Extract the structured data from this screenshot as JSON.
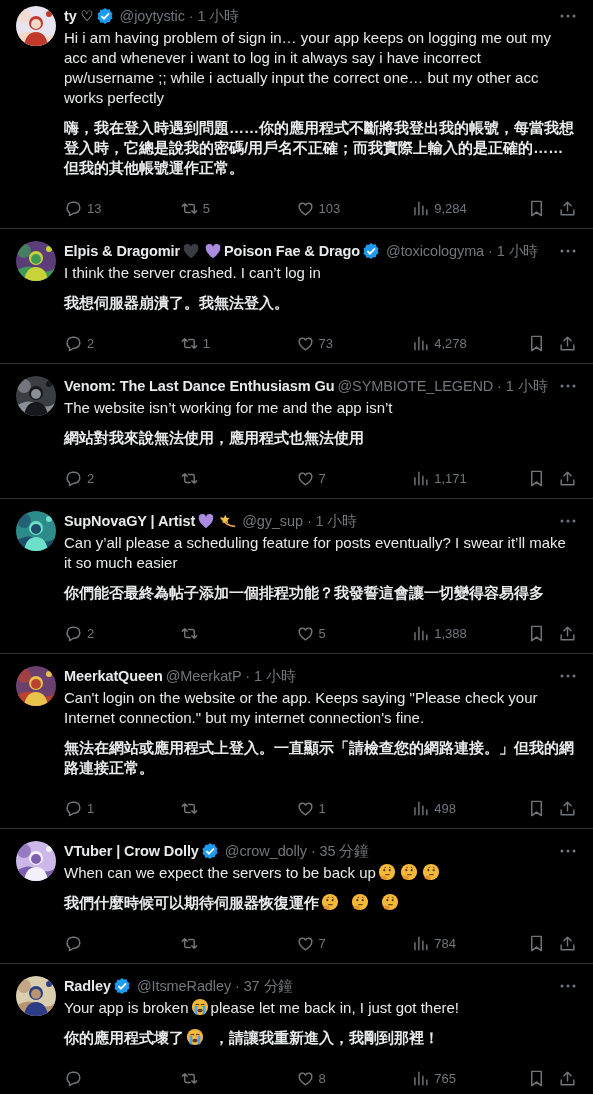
{
  "replies": [
    {
      "name": [
        {
          "kind": "text",
          "text": "ty ♡"
        }
      ],
      "verified": true,
      "handle": "@joytystic · 1 小時",
      "body": [
        {
          "kind": "text",
          "text": "Hi i am having problem of sign in… your app keeps on logging me out my acc and whenever i want to log in it always say i have incorrect pw/username ;; while i actually input the correct one… but my other acc works perfectly"
        }
      ],
      "translation": [
        {
          "kind": "text",
          "text": "嗨，我在登入時遇到問題……你的應用程式不斷將我登出我的帳號，每當我想登入時，它總是說我的密碼/用戶名不正確；而我實際上輸入的是正確的……但我的其他帳號運作正常。"
        }
      ],
      "stats": {
        "replies": "13",
        "reposts": "5",
        "likes": "103",
        "views": "9,284"
      }
    },
    {
      "name": [
        {
          "kind": "text",
          "text": "Elpis & Dragomir"
        },
        {
          "kind": "dark-heart"
        },
        {
          "kind": "purple-heart"
        },
        {
          "kind": "text",
          "text": "Poison Fae & Drago"
        }
      ],
      "verified": true,
      "handle": "@toxicologyma · 1 小時",
      "body": [
        {
          "kind": "text",
          "text": "I think the server crashed. I can’t log in"
        }
      ],
      "translation": [
        {
          "kind": "text",
          "text": "我想伺服器崩潰了。我無法登入。"
        }
      ],
      "stats": {
        "replies": "2",
        "reposts": "1",
        "likes": "73",
        "views": "4,278"
      }
    },
    {
      "name": [
        {
          "kind": "text",
          "text": "Venom: The Last Dance Enthusiasm Gu"
        }
      ],
      "verified": false,
      "handle": "@SYMBIOTE_LEGEND · 1 小時",
      "body": [
        {
          "kind": "text",
          "text": "The website isn’t working for me and the app isn’t"
        }
      ],
      "translation": [
        {
          "kind": "text",
          "text": "網站對我來說無法使用，應用程式也無法使用"
        }
      ],
      "stats": {
        "replies": "2",
        "likes": "7",
        "views": "1,171"
      }
    },
    {
      "name": [
        {
          "kind": "text",
          "text": "SupNovaGY | Artist"
        },
        {
          "kind": "purple-heart"
        },
        {
          "kind": "star"
        }
      ],
      "verified": false,
      "handle": "@gy_sup · 1 小時",
      "body": [
        {
          "kind": "text",
          "text": "Can y’all please a scheduling feature for posts eventually? I swear it’ll make it so much easier"
        }
      ],
      "translation": [
        {
          "kind": "text",
          "text": "你們能否最終為帖子添加一個排程功能？我發誓這會讓一切變得容易得多"
        }
      ],
      "stats": {
        "replies": "2",
        "likes": "5",
        "views": "1,388"
      }
    },
    {
      "name": [
        {
          "kind": "text",
          "text": "MeerkatQueen"
        }
      ],
      "verified": false,
      "handle": "@MeerkatP · 1 小時",
      "body": [
        {
          "kind": "text",
          "text": "Can't login on  the website or the app. Keeps saying \"Please check your Internet connection.\" but my internet connection's fine."
        }
      ],
      "translation": [
        {
          "kind": "text",
          "text": "無法在網站或應用程式上登入。一直顯示「請檢查您的網路連接。」但我的網路連接正常。"
        }
      ],
      "stats": {
        "replies": "1",
        "likes": "1",
        "views": "498"
      }
    },
    {
      "name": [
        {
          "kind": "text",
          "text": "VTuber | Crow Dolly"
        }
      ],
      "verified": true,
      "handle": "@crow_dolly · 35 分鐘",
      "body": [
        {
          "kind": "text",
          "text": "When can we expect the servers to be back up"
        },
        {
          "kind": "thinking"
        },
        {
          "kind": "thinking"
        },
        {
          "kind": "thinking"
        }
      ],
      "translation": [
        {
          "kind": "text",
          "text": "我們什麼時候可以期待伺服器恢復運作"
        },
        {
          "kind": "thinking"
        },
        {
          "kind": "gap"
        },
        {
          "kind": "thinking"
        },
        {
          "kind": "gap"
        },
        {
          "kind": "thinking"
        }
      ],
      "stats": {
        "likes": "7",
        "views": "784"
      }
    },
    {
      "name": [
        {
          "kind": "text",
          "text": "Radley"
        }
      ],
      "verified": true,
      "handle": "@ItsmeRadley · 37 分鐘",
      "body": [
        {
          "kind": "text",
          "text": "Your app is broken"
        },
        {
          "kind": "crying"
        },
        {
          "kind": "text",
          "text": "please let me back in, I just got there!"
        }
      ],
      "translation": [
        {
          "kind": "text",
          "text": "你的應用程式壞了"
        },
        {
          "kind": "crying"
        },
        {
          "kind": "gap"
        },
        {
          "kind": "text",
          "text": "，請讓我重新進入，我剛到那裡！"
        }
      ],
      "stats": {
        "likes": "8",
        "views": "765"
      }
    }
  ]
}
